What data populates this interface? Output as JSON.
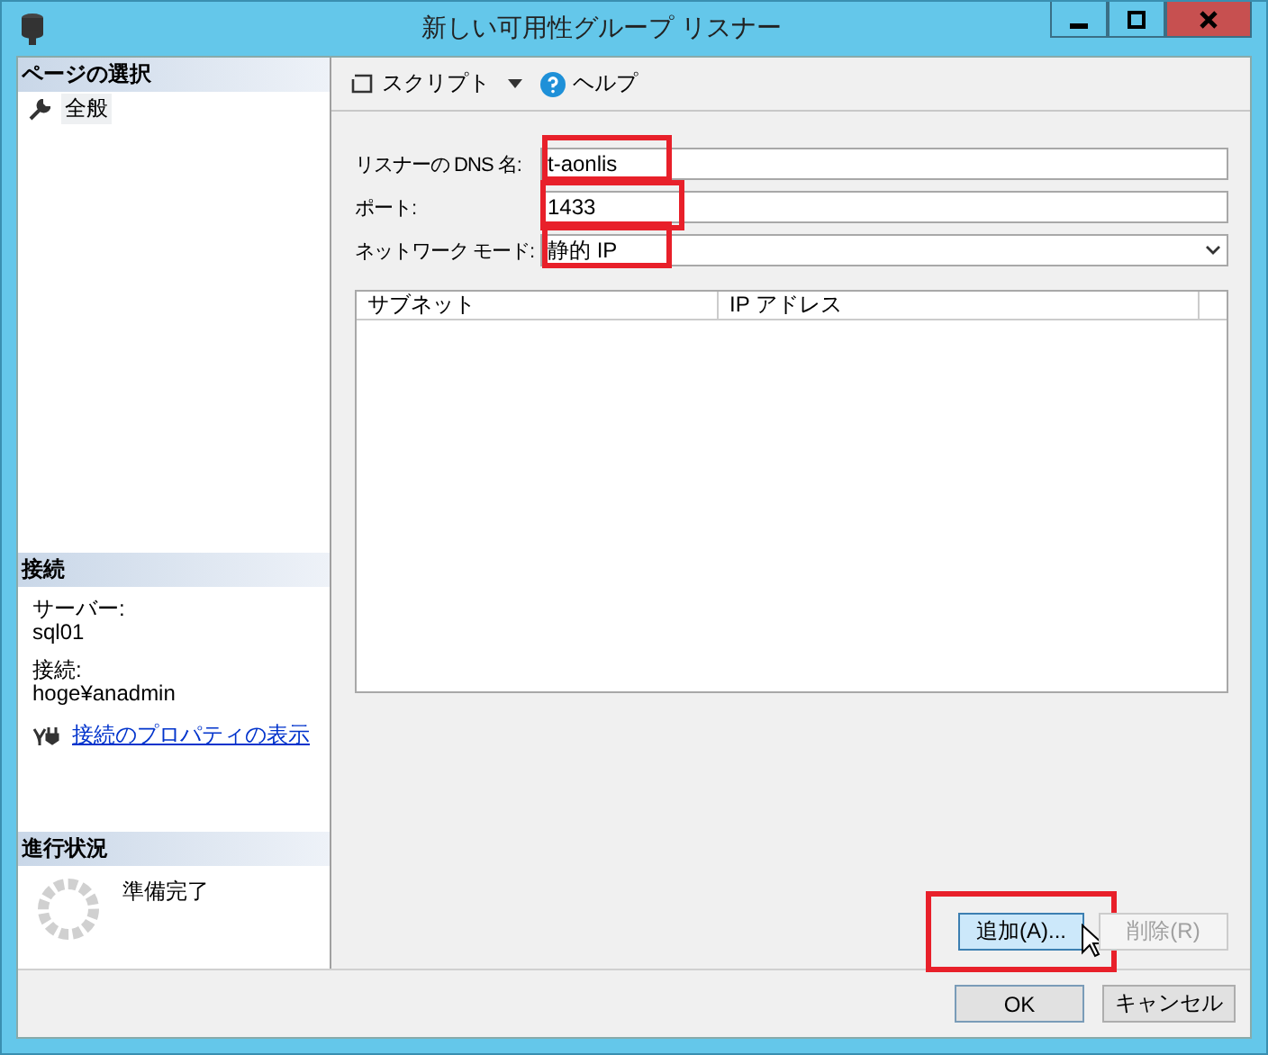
{
  "window": {
    "title": "新しい可用性グループ リスナー"
  },
  "sidebar": {
    "page_select": {
      "heading": "ページの選択",
      "items": [
        {
          "label": "全般",
          "selected": true
        }
      ]
    },
    "connection": {
      "heading": "接続",
      "server_label": "サーバー:",
      "server": "sql01",
      "connection_label": "接続:",
      "connection": "hoge¥anadmin",
      "link": "接続のプロパティの表示"
    },
    "progress": {
      "heading": "進行状況",
      "status": "準備完了"
    }
  },
  "toolbar": {
    "script": "スクリプト",
    "help": "ヘルプ"
  },
  "fields": [
    {
      "kind": "text",
      "label": "リスナーの DNS 名:",
      "value": "t-aonlis",
      "highlighted": true
    },
    {
      "kind": "text",
      "label": "ポート:",
      "value": "1433",
      "highlighted": true
    },
    {
      "kind": "dropdown",
      "label": "ネットワーク モード:",
      "value": "静的 IP",
      "highlighted": true
    }
  ],
  "table": {
    "columns": [
      "サブネット",
      "IP アドレス"
    ]
  },
  "table_buttons": [
    {
      "label": "追加(A)...",
      "disabled": false,
      "hovered": true,
      "highlighted": true
    },
    {
      "label": "削除(R)",
      "disabled": true,
      "hovered": false,
      "highlighted": false
    }
  ],
  "dialog_buttons": [
    "OK",
    "キャンセル"
  ]
}
